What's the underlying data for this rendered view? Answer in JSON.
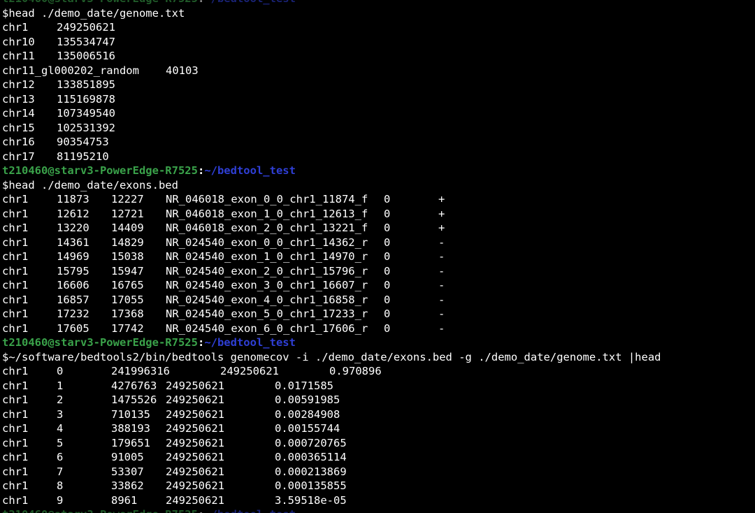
{
  "prompt": {
    "user_host": "t210460@starv3-PowerEdge-R7525",
    "separator": ":",
    "path": "~/bedtool_test"
  },
  "blocks": {
    "genome": {
      "command": "$head ./demo_date/genome.txt",
      "rows": [
        [
          "chr1",
          "249250621"
        ],
        [
          "chr10",
          "135534747"
        ],
        [
          "chr11",
          "135006516"
        ],
        [
          "chr11_gl000202_random",
          "40103"
        ],
        [
          "chr12",
          "133851895"
        ],
        [
          "chr13",
          "115169878"
        ],
        [
          "chr14",
          "107349540"
        ],
        [
          "chr15",
          "102531392"
        ],
        [
          "chr16",
          "90354753"
        ],
        [
          "chr17",
          "81195210"
        ]
      ]
    },
    "exons": {
      "command": "$head ./demo_date/exons.bed",
      "rows": [
        [
          "chr1",
          "11873",
          "12227",
          "NR_046018_exon_0_0_chr1_11874_f",
          "0",
          "+"
        ],
        [
          "chr1",
          "12612",
          "12721",
          "NR_046018_exon_1_0_chr1_12613_f",
          "0",
          "+"
        ],
        [
          "chr1",
          "13220",
          "14409",
          "NR_046018_exon_2_0_chr1_13221_f",
          "0",
          "+"
        ],
        [
          "chr1",
          "14361",
          "14829",
          "NR_024540_exon_0_0_chr1_14362_r",
          "0",
          "-"
        ],
        [
          "chr1",
          "14969",
          "15038",
          "NR_024540_exon_1_0_chr1_14970_r",
          "0",
          "-"
        ],
        [
          "chr1",
          "15795",
          "15947",
          "NR_024540_exon_2_0_chr1_15796_r",
          "0",
          "-"
        ],
        [
          "chr1",
          "16606",
          "16765",
          "NR_024540_exon_3_0_chr1_16607_r",
          "0",
          "-"
        ],
        [
          "chr1",
          "16857",
          "17055",
          "NR_024540_exon_4_0_chr1_16858_r",
          "0",
          "-"
        ],
        [
          "chr1",
          "17232",
          "17368",
          "NR_024540_exon_5_0_chr1_17233_r",
          "0",
          "-"
        ],
        [
          "chr1",
          "17605",
          "17742",
          "NR_024540_exon_6_0_chr1_17606_r",
          "0",
          "-"
        ]
      ]
    },
    "genomecov": {
      "command": "$~/software/bedtools2/bin/bedtools genomecov -i ./demo_date/exons.bed -g ./demo_date/genome.txt |head",
      "rows": [
        [
          "chr1",
          "0",
          "241996316",
          "249250621",
          "0.970896"
        ],
        [
          "chr1",
          "1",
          "4276763",
          "249250621",
          "0.0171585"
        ],
        [
          "chr1",
          "2",
          "1475526",
          "249250621",
          "0.00591985"
        ],
        [
          "chr1",
          "3",
          "710135",
          "249250621",
          "0.00284908"
        ],
        [
          "chr1",
          "4",
          "388193",
          "249250621",
          "0.00155744"
        ],
        [
          "chr1",
          "5",
          "179651",
          "249250621",
          "0.000720765"
        ],
        [
          "chr1",
          "6",
          "91005",
          "249250621",
          "0.000365114"
        ],
        [
          "chr1",
          "7",
          "53307",
          "249250621",
          "0.000213869"
        ],
        [
          "chr1",
          "8",
          "33862",
          "249250621",
          "0.000135855"
        ],
        [
          "chr1",
          "9",
          "8961",
          "249250621",
          "3.59518e-05"
        ]
      ]
    }
  },
  "colors": {
    "background": "#000000",
    "text": "#ffffff",
    "prompt_user": "#3aa24a",
    "prompt_path": "#2f3fd6"
  }
}
